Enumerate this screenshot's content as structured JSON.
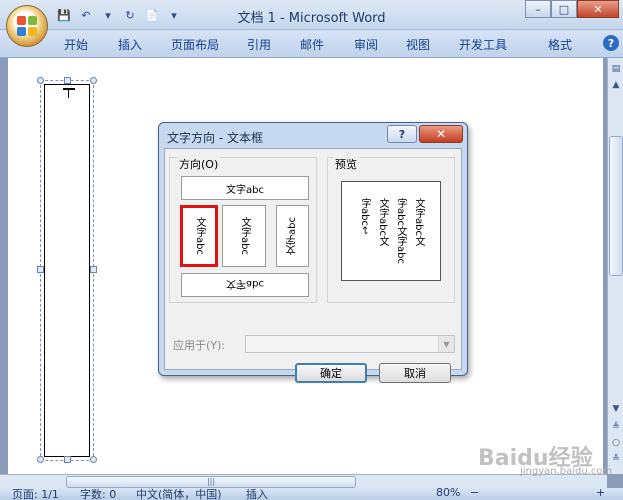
{
  "window": {
    "title": "文档 1 - Microsoft Word",
    "controls": {
      "minimize": "–",
      "maximize": "□",
      "close": "✕"
    }
  },
  "qat": {
    "save": "💾",
    "undo": "↶",
    "dropdown": "▾",
    "redo": "↻",
    "new": "📄",
    "customize": "▾"
  },
  "ribbon_tabs": [
    "开始",
    "插入",
    "页面布局",
    "引用",
    "邮件",
    "审阅",
    "视图",
    "开发工具",
    "格式"
  ],
  "help": "?",
  "dialog": {
    "title": "文字方向 - 文本框",
    "help": "?",
    "close": "✕",
    "direction_label": "方向(O)",
    "preview_label": "预览",
    "options": {
      "horizontal_top": "文字abc",
      "vertical_selected": "文字abc",
      "stacked": "文字abc",
      "rotated_ccw": "文字abc",
      "horizontal_bottom": "文字abc"
    },
    "preview_columns": [
      "文字abc文",
      "字abc文字abc",
      "文字abc文",
      "字abc↩"
    ],
    "apply_label": "应用于(Y):",
    "apply_value": "",
    "ok": "确定",
    "cancel": "取消"
  },
  "statusbar": {
    "page": "页面: 1/1",
    "words": "字数: 0",
    "language": "中文(简体，中国)",
    "mode": "插入",
    "zoom": "80%",
    "zoom_out": "−",
    "zoom_in": "+"
  },
  "watermark": "Baidu经验",
  "watermark_url": "jingyan.baidu.com",
  "colors": {
    "accent": "#15428b",
    "selection": "#e21010",
    "titlebar": "#c5d6ec"
  }
}
